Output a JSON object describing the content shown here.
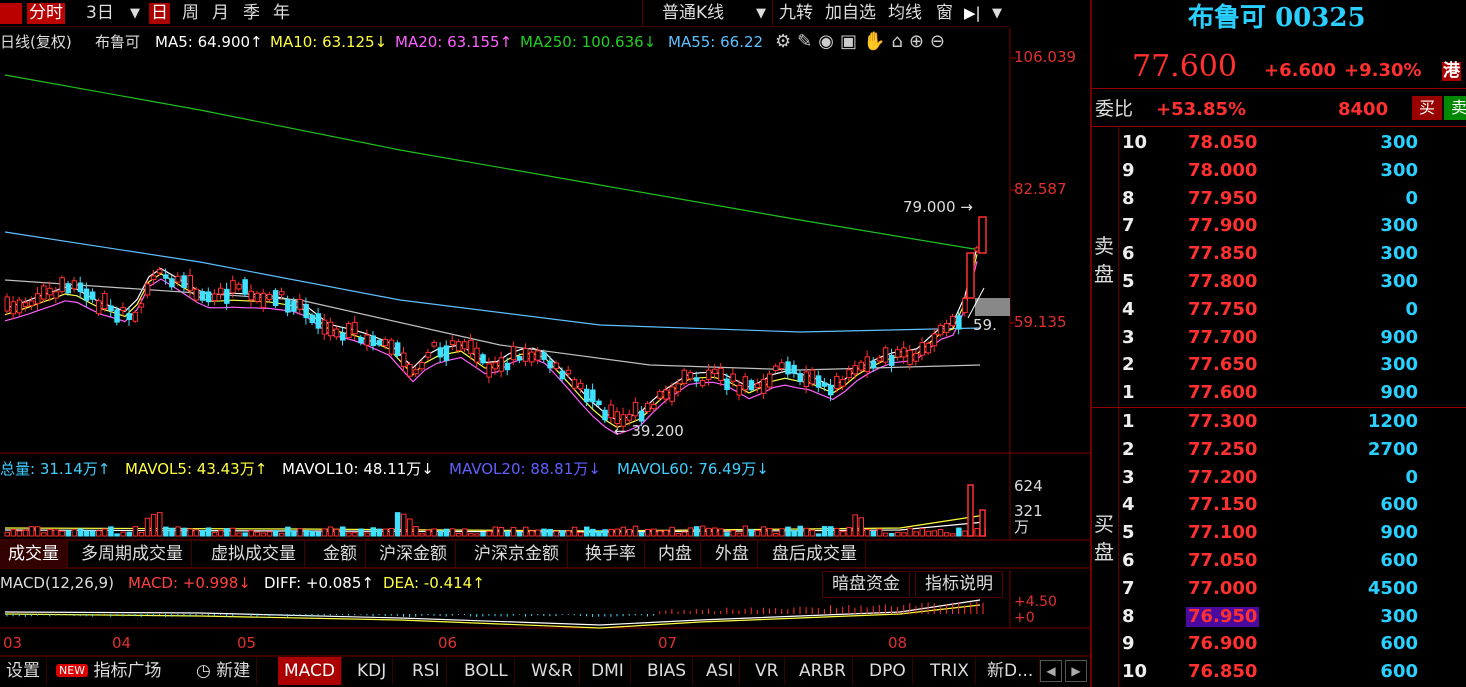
{
  "topbar": {
    "tabs": [
      "分时",
      "3日",
      "日",
      "周",
      "月",
      "季",
      "年"
    ],
    "kline_type": "普通K线",
    "buttons": [
      "九转",
      "加自选",
      "均线",
      "窗"
    ]
  },
  "ma_line": {
    "prefix": "日线(复权)",
    "stock": "布鲁可",
    "ma5": "MA5: 64.900↑",
    "ma10": "MA10: 63.125↓",
    "ma20": "MA20: 63.155↑",
    "ma250": "MA250: 100.636↓",
    "ma55": "MA55: 66.22"
  },
  "price_axis": [
    "106.039",
    "82.587",
    "59.135"
  ],
  "annotations": {
    "high": "79.000",
    "low": "39.200",
    "last": "59."
  },
  "volume": {
    "label": "总量: 31.14万↑",
    "mavol5": "MAVOL5: 43.43万↑",
    "mavol10": "MAVOL10: 48.11万↓",
    "mavol20": "MAVOL20: 88.81万↓",
    "mavol60": "MAVOL60: 76.49万↓",
    "axis": [
      "624",
      "321",
      "万"
    ]
  },
  "volume_tabs": [
    "成交量",
    "多周期成交量",
    "虚拟成交量",
    "金额",
    "沪深金额",
    "沪深京金额",
    "换手率",
    "内盘",
    "外盘",
    "盘后成交量"
  ],
  "macd": {
    "label": "MACD(12,26,9)",
    "macd": "MACD: +0.998↓",
    "diff": "DIFF: +0.085↑",
    "dea": "DEA: -0.414↑",
    "btn1": "暗盘资金",
    "btn2": "指标说明",
    "axis": [
      "+4.50",
      "+0"
    ]
  },
  "months": [
    "03",
    "04",
    "05",
    "06",
    "07",
    "08"
  ],
  "bottom_tabs": {
    "settings": "设置",
    "new_badge": "NEW",
    "indicator_square": "指标广场",
    "create": "新建",
    "items": [
      "MACD",
      "KDJ",
      "RSI",
      "BOLL",
      "W&R",
      "DMI",
      "BIAS",
      "ASI",
      "VR",
      "ARBR",
      "DPO",
      "TRIX",
      "新D..."
    ]
  },
  "quote": {
    "name": "布鲁可",
    "code": "00325",
    "price": "77.600",
    "change": "+6.600",
    "pct": "+9.30%",
    "market": "港",
    "weibi_label": "委比",
    "weibi": "+53.85%",
    "weicha": "8400",
    "buy_btn": "买",
    "sell_btn": "卖",
    "sell_label": "卖盘",
    "buy_label": "买盘",
    "asks": [
      {
        "lvl": "10",
        "price": "78.050",
        "vol": "300"
      },
      {
        "lvl": "9",
        "price": "78.000",
        "vol": "300"
      },
      {
        "lvl": "8",
        "price": "77.950",
        "vol": "0"
      },
      {
        "lvl": "7",
        "price": "77.900",
        "vol": "300"
      },
      {
        "lvl": "6",
        "price": "77.850",
        "vol": "300"
      },
      {
        "lvl": "5",
        "price": "77.800",
        "vol": "300"
      },
      {
        "lvl": "4",
        "price": "77.750",
        "vol": "0"
      },
      {
        "lvl": "3",
        "price": "77.700",
        "vol": "900"
      },
      {
        "lvl": "2",
        "price": "77.650",
        "vol": "300"
      },
      {
        "lvl": "1",
        "price": "77.600",
        "vol": "900"
      }
    ],
    "bids": [
      {
        "lvl": "1",
        "price": "77.300",
        "vol": "1200"
      },
      {
        "lvl": "2",
        "price": "77.250",
        "vol": "2700"
      },
      {
        "lvl": "3",
        "price": "77.200",
        "vol": "0"
      },
      {
        "lvl": "4",
        "price": "77.150",
        "vol": "600"
      },
      {
        "lvl": "5",
        "price": "77.100",
        "vol": "900"
      },
      {
        "lvl": "6",
        "price": "77.050",
        "vol": "600"
      },
      {
        "lvl": "7",
        "price": "77.000",
        "vol": "4500"
      },
      {
        "lvl": "8",
        "price": "76.950",
        "vol": "300"
      },
      {
        "lvl": "9",
        "price": "76.900",
        "vol": "600"
      },
      {
        "lvl": "10",
        "price": "76.850",
        "vol": "600"
      }
    ]
  },
  "colors": {
    "up": "#e03030",
    "down": "#40e0ff",
    "ma5": "#ffffff",
    "ma10": "#ffff40",
    "ma20": "#ff60ff",
    "ma250": "#20c020",
    "ma55": "#60c0ff"
  }
}
